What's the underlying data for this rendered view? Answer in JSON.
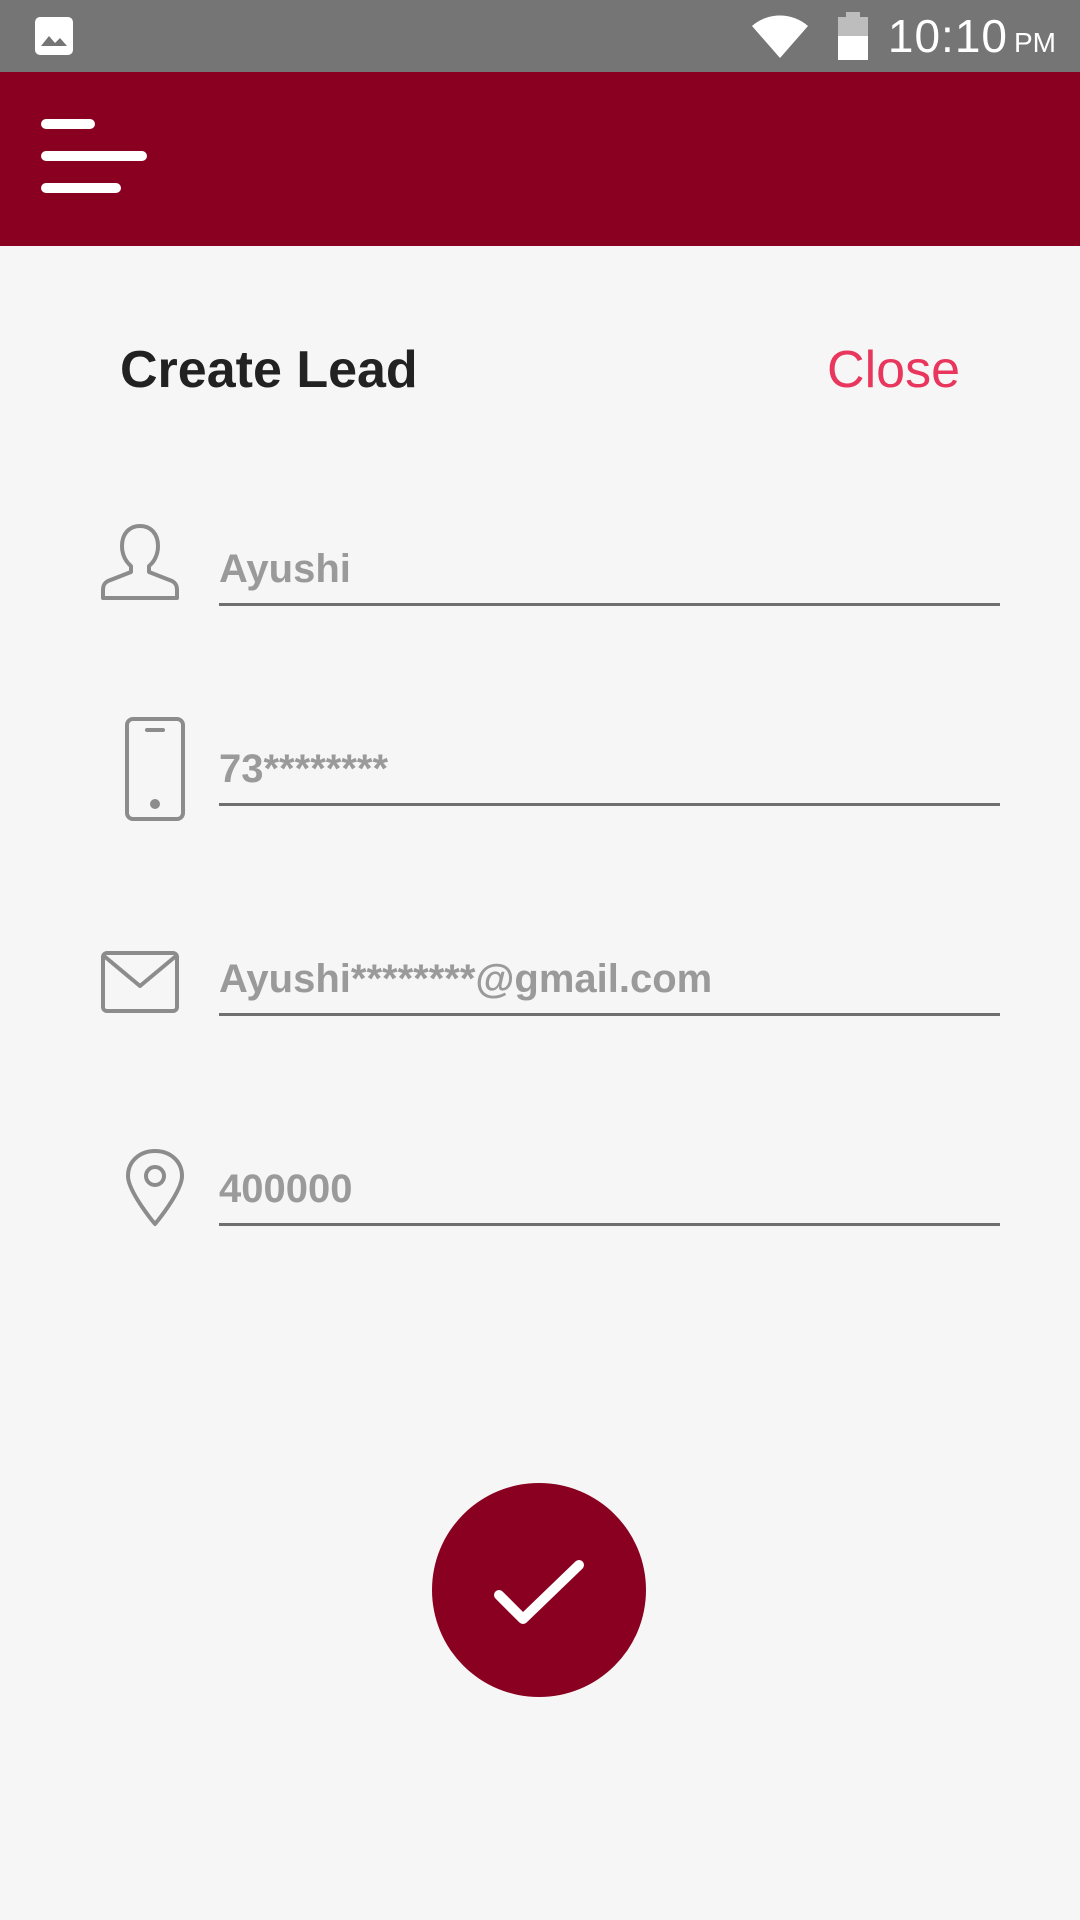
{
  "status_bar": {
    "time": "10:10",
    "ampm": "PM",
    "icons": [
      "gallery-icon",
      "wifi-icon",
      "battery-icon"
    ]
  },
  "app_bar": {
    "menu_icon": "menu-icon"
  },
  "header": {
    "title": "Create Lead",
    "close_label": "Close"
  },
  "form": {
    "name_value": "Ayushi",
    "phone_value": "73********",
    "email_value": "Ayushi********@gmail.com",
    "pincode_value": "400000"
  },
  "submit": {
    "icon": "checkmark-icon"
  },
  "colors": {
    "app_bar": "#8a0020",
    "status_bar": "#757575",
    "close_text": "#e8365d",
    "background": "#f6f6f6",
    "input_text": "#9a9a9a"
  }
}
